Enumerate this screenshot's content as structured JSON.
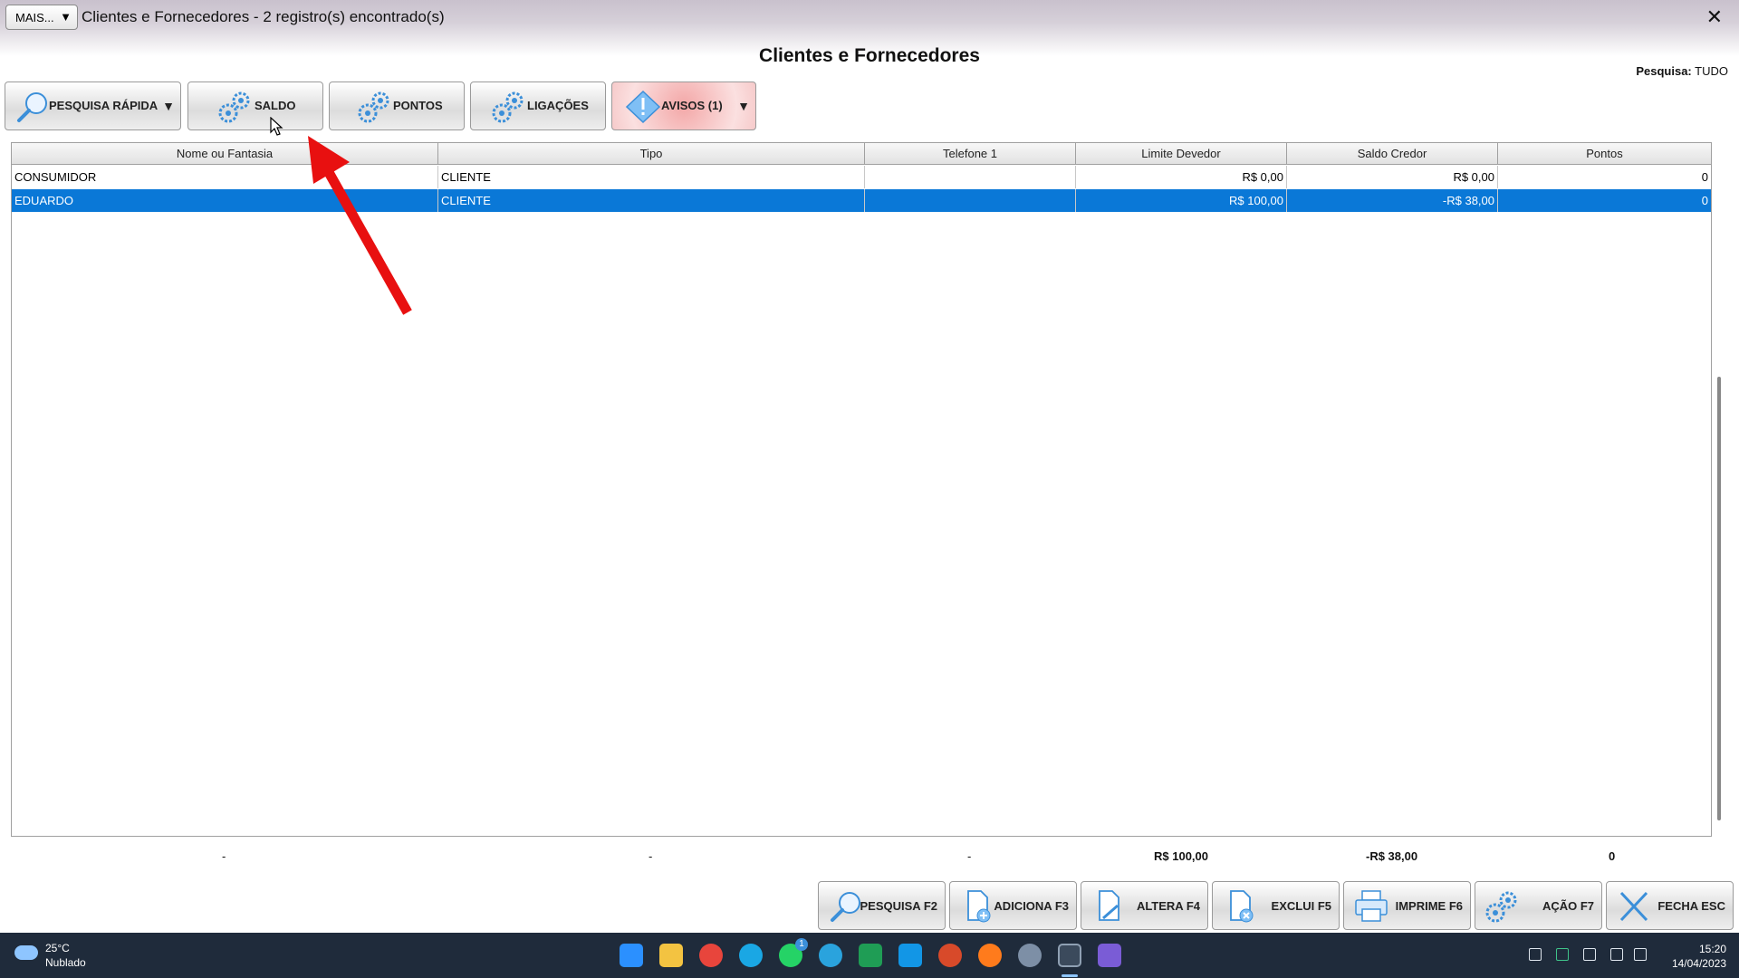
{
  "window": {
    "more_label": "MAIS...",
    "title": "Clientes e Fornecedores - 2 registro(s) encontrado(s)",
    "close": "✕",
    "page_title": "Clientes e Fornecedores",
    "search_scope_label": "Pesquisa:",
    "search_scope_value": "TUDO"
  },
  "toolbar": {
    "quick_search": "PESQUISA RÁPIDA",
    "balance": "SALDO",
    "points": "PONTOS",
    "calls": "LIGAÇÕES",
    "warnings": "AVISOS (1)",
    "dropdown_glyph": "▼"
  },
  "table": {
    "columns": [
      "Nome ou Fantasia",
      "Tipo",
      "Telefone 1",
      "Limite Devedor",
      "Saldo Credor",
      "Pontos"
    ],
    "rows": [
      [
        "CONSUMIDOR",
        "CLIENTE",
        "",
        "R$ 0,00",
        "R$ 0,00",
        "0"
      ],
      [
        "EDUARDO",
        "CLIENTE",
        "",
        "R$ 100,00",
        "-R$ 38,00",
        "0"
      ]
    ],
    "selected_row": 1,
    "totals": [
      "-",
      "-",
      "-",
      "R$ 100,00",
      "-R$ 38,00",
      "0"
    ]
  },
  "actions": {
    "search": "PESQUISA F2",
    "add": "ADICIONA F3",
    "edit": "ALTERA F4",
    "delete": "EXCLUI F5",
    "print": "IMPRIME F6",
    "action": "AÇÃO F7",
    "close": "FECHA ESC"
  },
  "taskbar": {
    "temperature": "25°C",
    "weather": "Nublado",
    "time": "15:20",
    "date": "14/04/2023",
    "whatsapp_badge": "1"
  },
  "colors": {
    "selection": "#0a78d7",
    "annotation_arrow": "#e81010",
    "taskbar": "#1f2b3b"
  }
}
